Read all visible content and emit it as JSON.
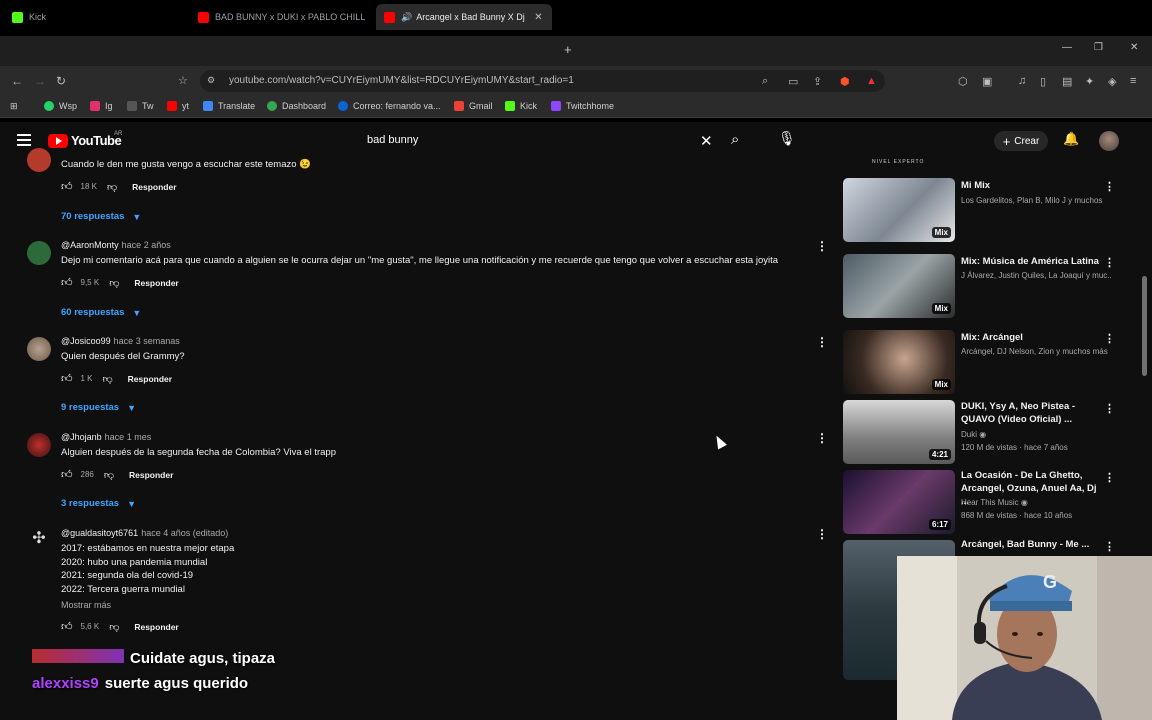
{
  "tabs": [
    {
      "title": "Kick",
      "color": "#53fc18",
      "active": false
    },
    {
      "title": "BAD BUNNY x DUKI x PABLO CHILL",
      "color": "#ff0000",
      "active": false
    },
    {
      "title": "Arcangel x Bad Bunny X Dj Lu",
      "color": "#ff0000",
      "active": true
    }
  ],
  "browser": {
    "url": "youtube.com/watch?v=CUYrEiymUMY&list=RDCUYrEiymUMY&start_radio=1",
    "new_tab": "+",
    "minimize": "—",
    "maximize": "❐",
    "close": "✕"
  },
  "bookmarks": [
    {
      "label": "Wsp",
      "color": "#25d366"
    },
    {
      "label": "Ig",
      "color": "#e1306c"
    },
    {
      "label": "Tw",
      "color": "#555555"
    },
    {
      "label": "yt",
      "color": "#ff0000"
    },
    {
      "label": "Translate",
      "color": "#4285f4"
    },
    {
      "label": "Dashboard",
      "color": "#34a853"
    },
    {
      "label": "Correo: fernando va...",
      "color": "#0a64d6"
    },
    {
      "label": "Gmail",
      "color": "#ea4335"
    },
    {
      "label": "Kick",
      "color": "#53fc18"
    },
    {
      "label": "Twitchhome",
      "color": "#9146ff"
    }
  ],
  "youtube": {
    "logo": "YouTube",
    "region": "AR",
    "search_query": "bad bunny",
    "create_label": "Crear"
  },
  "comments": [
    {
      "text": "Cuando le den me gusta vengo a escuchar este temazo 😉",
      "likes": "18 K",
      "reply_label": "Responder",
      "replies": "70 respuestas"
    },
    {
      "author": "@AaronMonty",
      "time": "hace 2 años",
      "text": "Dejo mi comentario acá para que cuando a alguien se le ocurra dejar un \"me gusta\", me llegue una notificación y me recuerde que tengo que volver a escuchar esta joyita",
      "likes": "9,5 K",
      "reply_label": "Responder",
      "replies": "60 respuestas"
    },
    {
      "author": "@Josicoo99",
      "time": "hace 3 semanas",
      "text": "Quien después del Grammy?",
      "likes": "1 K",
      "reply_label": "Responder",
      "replies": "9 respuestas"
    },
    {
      "author": "@Jhojanb",
      "time": "hace 1 mes",
      "text": "Alguien después de la segunda fecha de Colombia? Viva el trapp",
      "likes": "286",
      "reply_label": "Responder",
      "replies": "3 respuestas"
    },
    {
      "author": "@gualdasitoyt6761",
      "time": "hace 4 años (editado)",
      "lines": [
        "2017: estábamos en nuestra mejor etapa",
        "2020: hubo una pandemia mundial",
        "2021: segunda ola del covid-19",
        "2022: Tercera guerra mundial"
      ],
      "more": "Mostrar más",
      "likes": "5,6 K",
      "reply_label": "Responder"
    }
  ],
  "sidebar": {
    "top_label": "NIVEL EXPERTO",
    "items": [
      {
        "title": "Mi Mix",
        "sub1": "Los Gardelitos, Plan B, Milo J y muchos",
        "sub2": "",
        "badge": "Mix"
      },
      {
        "title": "Mix: Música de América Latina",
        "sub1": "J Álvarez, Justin Quiles, La Joaquí y muc...",
        "sub2": "",
        "badge": "Mix"
      },
      {
        "title": "Mix: Arcángel",
        "sub1": "Arcángel, DJ Nelson, Zion y muchos más",
        "sub2": "",
        "badge": "Mix"
      },
      {
        "title": "DUKI, Ysy A, Neo Pistea - QUAVO (Video Oficial) ...",
        "sub1": "Duki ◉",
        "sub2": "120 M de vistas · hace 7 años",
        "badge": "4:21"
      },
      {
        "title": "La Ocasión - De La Ghetto, Arcangel, Ozuna, Anuel Aa, Dj ...",
        "sub1": "Hear This Music ◉",
        "sub2": "868 M de vistas · hace 10 años",
        "badge": "6:17"
      },
      {
        "title": "Arcángel, Bad Bunny - Me ...",
        "sub1": "",
        "sub2": "",
        "badge": ""
      }
    ]
  },
  "chat": [
    {
      "user": "",
      "message": "Cuidate agus, tipaza"
    },
    {
      "user": "alexxiss9",
      "message": "suerte agus querido"
    }
  ]
}
